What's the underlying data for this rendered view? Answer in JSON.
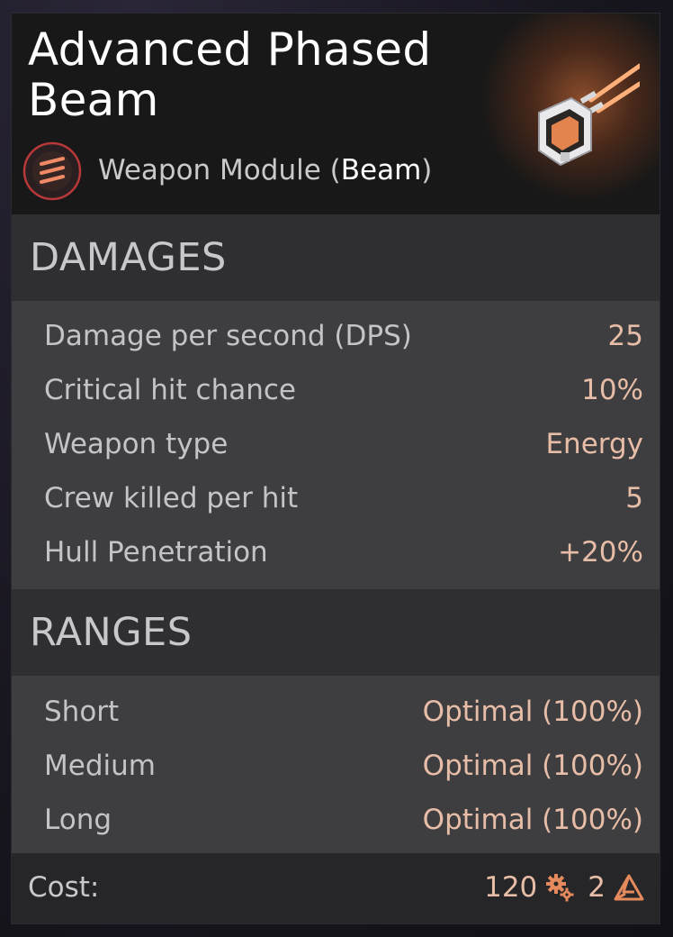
{
  "item": {
    "title": "Advanced Phased Beam",
    "subtitle_prefix": "Weapon Module (",
    "subtitle_type": "Beam",
    "subtitle_suffix": ")",
    "icon": "beam-weapon-module-icon",
    "type_icon": "beam-type-icon"
  },
  "sections": {
    "damages": {
      "title": "DAMAGES",
      "rows": [
        {
          "label": "Damage per second (DPS)",
          "value": "25"
        },
        {
          "label": "Critical hit chance",
          "value": "10%"
        },
        {
          "label": "Weapon type",
          "value": "Energy"
        },
        {
          "label": "Crew killed per hit",
          "value": "5"
        },
        {
          "label": "Hull Penetration",
          "value": "+20%"
        }
      ]
    },
    "ranges": {
      "title": "RANGES",
      "rows": [
        {
          "label": "Short",
          "value": "Optimal (100%)"
        },
        {
          "label": "Medium",
          "value": "Optimal (100%)"
        },
        {
          "label": "Long",
          "value": "Optimal (100%)"
        }
      ]
    }
  },
  "cost": {
    "label": "Cost:",
    "parts_amount": "120",
    "parts_icon": "gears-icon",
    "special_amount": "2",
    "special_icon": "triangle-resource-icon"
  },
  "colors": {
    "accent": "#e58a5c",
    "value_text": "#e7bda7",
    "badge_ring": "#b8383a"
  }
}
